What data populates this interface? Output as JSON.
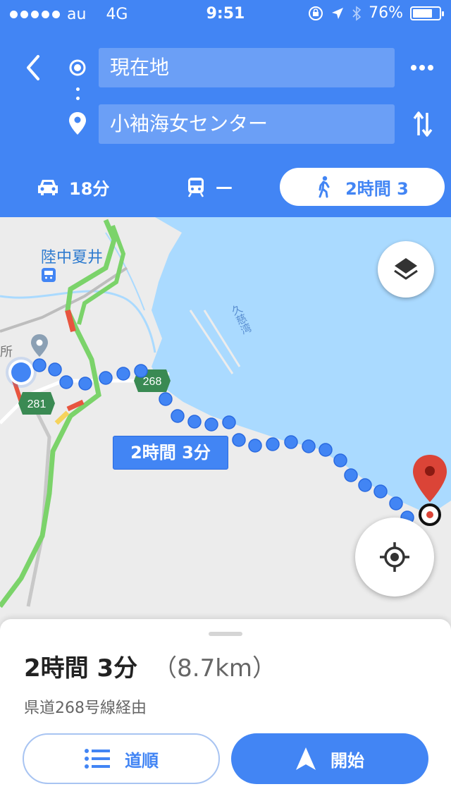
{
  "status_bar": {
    "carrier": "au",
    "network": "4G",
    "time": "9:51",
    "battery": "76%",
    "battery_level": 0.76
  },
  "header": {
    "origin": "現在地",
    "destination": "小袖海女センター",
    "modes": {
      "drive": {
        "label": "18分",
        "icon": "car-icon"
      },
      "transit": {
        "label": "—",
        "icon": "train-icon"
      },
      "walk": {
        "label": "2時間 3",
        "icon": "walk-icon",
        "selected": true
      }
    }
  },
  "map": {
    "station_label": "陸中夏井",
    "bay_label": "久慈湾",
    "place_label": "所",
    "route_shields": [
      "268",
      "281"
    ],
    "route_label": "2時間 3分",
    "colors": {
      "route": "#4285f4",
      "water": "#aadaff",
      "land": "#ececec",
      "traffic_green": "#7bd36a",
      "traffic_yellow": "#f6d35c",
      "traffic_red": "#e8553f",
      "dest_pin": "#db4437"
    }
  },
  "sheet": {
    "duration": "2時間 3分",
    "distance": "（8.7km）",
    "via": "県道268号線経由",
    "steps_label": "道順",
    "start_label": "開始"
  },
  "colors": {
    "accent": "#4285f4"
  }
}
